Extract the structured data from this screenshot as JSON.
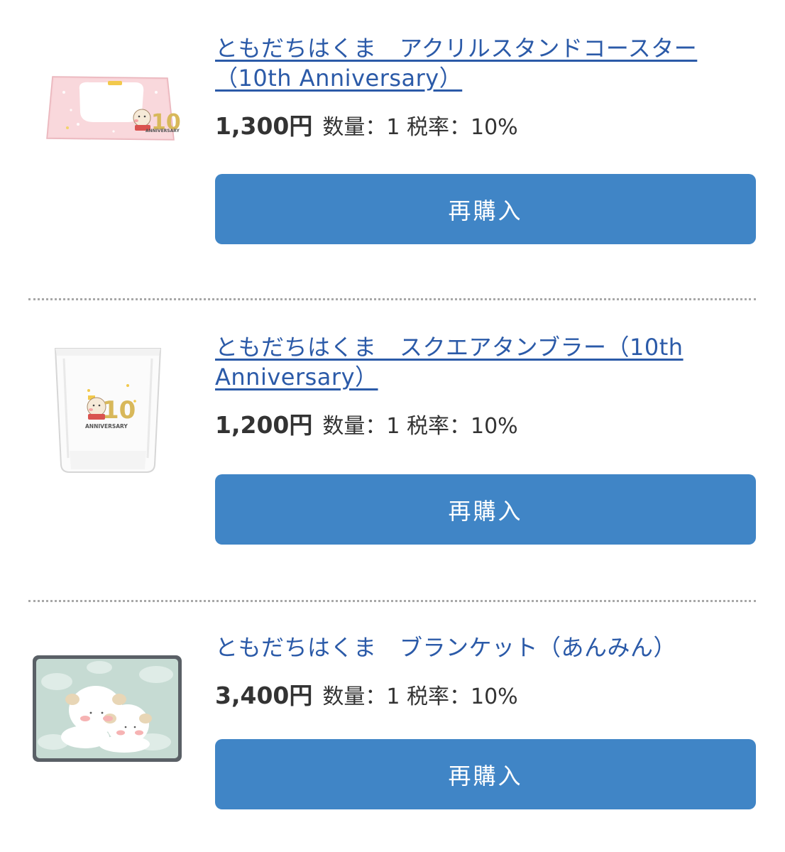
{
  "items": [
    {
      "title": "ともだちはくま　アクリルスタンドコースター（10th Anniversary）",
      "title_line1": "ともだちはくま　アクリルスタンドコースター",
      "title_line2": "（10th Anniversary）",
      "price": "1,300円",
      "meta": "数量：1 税率：10%",
      "rebuy_label": "再購入",
      "thumb_icon": "acrylic-coaster-image"
    },
    {
      "title": "ともだちはくま　スクエアタンブラー（10th Anniversary）",
      "title_line1": "ともだちはくま　スクエアタンブラー（10th",
      "title_line2": "Anniversary）",
      "price": "1,200円",
      "meta": "数量：1 税率：10%",
      "rebuy_label": "再購入",
      "thumb_icon": "square-tumbler-image"
    },
    {
      "title": "ともだちはくま　ブランケット（あんみん）",
      "title_line1": "ともだちはくま　ブランケット（あんみん）",
      "price": "3,400円",
      "meta": "数量：1 税率：10%",
      "rebuy_label": "再購入",
      "thumb_icon": "blanket-image"
    }
  ],
  "thumb_text": {
    "ten": "10",
    "anniversary": "ANNIVERSARY"
  },
  "colors": {
    "link": "#2b5aa8",
    "button": "#4085c6",
    "text": "#333333",
    "divider": "#a8a8a8"
  }
}
